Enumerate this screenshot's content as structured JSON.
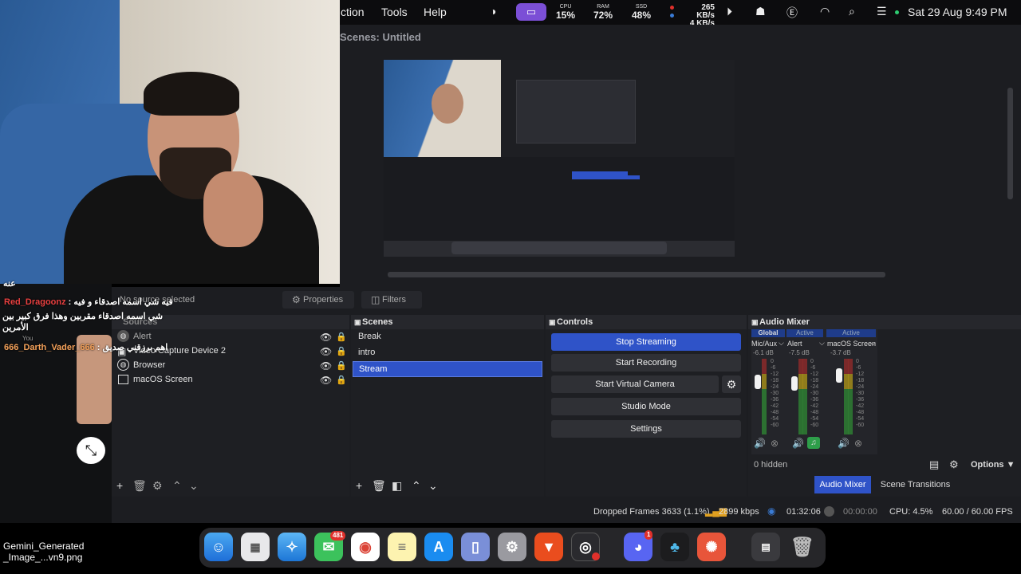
{
  "menubar": {
    "menus": [
      "ction",
      "Tools",
      "Help"
    ],
    "stats": [
      {
        "label": "CPU",
        "value": "15%"
      },
      {
        "label": "RAM",
        "value": "72%"
      },
      {
        "label": "SSD",
        "value": "48%"
      }
    ],
    "network_up": "265 KB/s",
    "network_down": "4 KB/s",
    "datetime": "Sat 29 Aug  9:49 PM",
    "icons": [
      "theme-icon",
      "screen-mirror-icon",
      "play-icon",
      "people-icon",
      "currency-icon",
      "wifi-icon",
      "search-icon",
      "control-center-icon"
    ]
  },
  "obs": {
    "preview_title": "Scenes: Untitled",
    "properties_label": "Properties",
    "filters_label": "Filters",
    "no_source": "No source selected",
    "sources": {
      "header": "Sources",
      "items": [
        "Alert",
        "Video Capture Device 2",
        "Browser",
        "macOS Screen"
      ]
    },
    "scenes": {
      "header": "Scenes",
      "items": [
        "Break",
        "intro",
        "Stream"
      ],
      "selected": "Stream"
    },
    "controls": {
      "header": "Controls",
      "stop_streaming": "Stop Streaming",
      "start_recording": "Start Recording",
      "start_virtual_camera": "Start Virtual Camera",
      "studio_mode": "Studio Mode",
      "settings": "Settings"
    },
    "audio_mixer": {
      "header": "Audio Mixer",
      "channels": [
        {
          "tag": "Global",
          "name": "Mic/Aux",
          "db": "-6.1 dB"
        },
        {
          "tag": "Active",
          "name": "Alert",
          "db": "-7.5 dB"
        },
        {
          "tag": "Active",
          "name": "macOS Screen",
          "db": "-3.7 dB"
        }
      ],
      "scale": [
        "0",
        "-6",
        "-12",
        "-18",
        "-24",
        "-30",
        "-36",
        "-42",
        "-48",
        "-54",
        "-60"
      ],
      "hidden": "0 hidden",
      "options": "Options"
    },
    "dock_tabs": [
      "Audio Mixer",
      "Scene Transitions"
    ],
    "status": {
      "dropped_frames": "Dropped Frames 3633 (1.1%)",
      "bitrate": "2899 kbps",
      "stream_time": "01:32:06",
      "rec_time": "00:00:00",
      "cpu": "CPU: 4.5%",
      "fps": "60.00 / 60.00 FPS"
    }
  },
  "chat": {
    "line0": "عنه",
    "name1": "Red_Dragoonz",
    "msg1": " : فيه شي اسمه اصدقاء و فيه",
    "msg1b": "شي اسمه اصدقاء مقربين وهذا فرق كبير بين",
    "msg1c": "الأمرين",
    "name2": "666_Darth_Vader_666",
    "msg2": " : اهم برزقني صديق",
    "you": "You"
  },
  "desktop_file": {
    "line1": "Gemini_Generated",
    "line2": "_Image_...vn9.png"
  },
  "dock": {
    "messages_badge": "481",
    "discord_badge": "1"
  },
  "colors": {
    "accent": "#2f53c8",
    "menubar_active": "#7b4fd6",
    "status_red": "#e0302b"
  }
}
